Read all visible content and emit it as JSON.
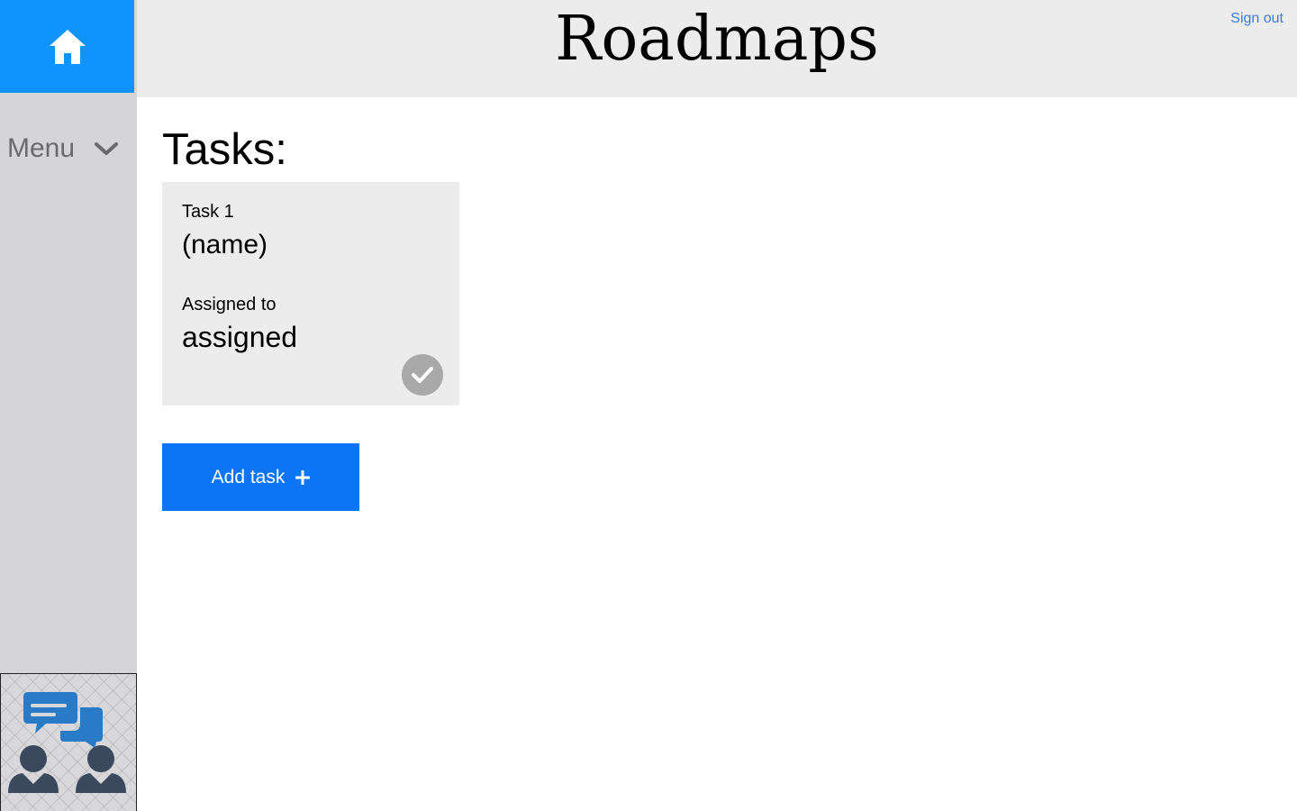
{
  "header": {
    "title": "Roadmaps",
    "signout_label": "Sign out"
  },
  "sidebar": {
    "home_icon": "home-icon",
    "menu_label": "Menu",
    "menu_icon": "chevron-down-icon",
    "illustration": "team-chat-illustration"
  },
  "main": {
    "heading": "Tasks:",
    "tasks": [
      {
        "number_label": "Task 1",
        "name": "(name)",
        "assigned_label": "Assigned to",
        "assigned_value": "assigned",
        "status_icon": "check-icon"
      }
    ],
    "add_task_label": "Add task",
    "add_task_icon": "plus-icon"
  },
  "colors": {
    "accent": "#0f93fd",
    "button": "#0c74f6",
    "link": "#3d7be0",
    "sidebar_bg": "#d5d4d6",
    "header_bg": "#ececec",
    "card_bg": "#ececec",
    "check_bg": "#a9a9a9"
  }
}
